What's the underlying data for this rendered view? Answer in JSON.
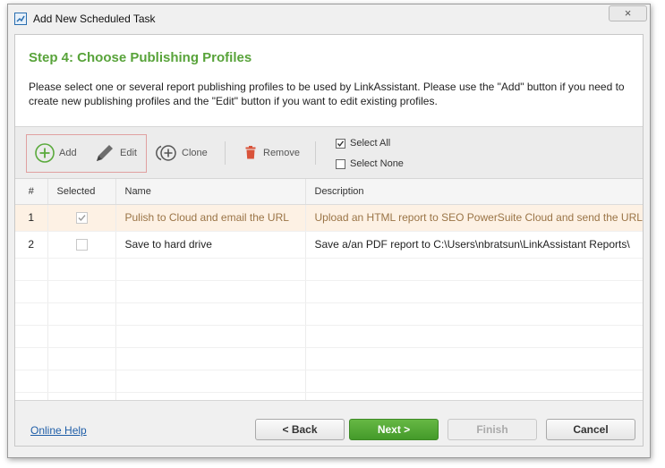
{
  "window": {
    "title": "Add New Scheduled Task",
    "close_glyph": "×"
  },
  "step": {
    "title": "Step 4: Choose Publishing Profiles",
    "instructions": "Please select one or several report publishing profiles to be used by LinkAssistant. Please use the \"Add\" button if you need to create new publishing profiles and the \"Edit\" button if you want to edit existing profiles."
  },
  "toolbar": {
    "add_label": "Add",
    "edit_label": "Edit",
    "clone_label": "Clone",
    "remove_label": "Remove",
    "select_all_label": "Select All",
    "select_none_label": "Select None",
    "select_all_checked": true,
    "select_none_checked": false
  },
  "table": {
    "columns": [
      "#",
      "Selected",
      "Name",
      "Description"
    ],
    "rows": [
      {
        "num": "1",
        "checked": true,
        "name": "Pulish to Cloud and email the URL",
        "description": "Upload an HTML report to SEO PowerSuite Cloud and send the URL"
      },
      {
        "num": "2",
        "checked": false,
        "name": "Save to hard drive",
        "description": "Save a/an PDF report to C:\\Users\\nbratsun\\LinkAssistant Reports\\"
      }
    ]
  },
  "footer": {
    "help_label": "Online Help",
    "back_label": "< Back",
    "next_label": "Next >",
    "finish_label": "Finish",
    "cancel_label": "Cancel"
  },
  "colors": {
    "accent_green": "#58a33a",
    "selected_row": "#fdf1e4",
    "remove_red": "#d9533a"
  }
}
